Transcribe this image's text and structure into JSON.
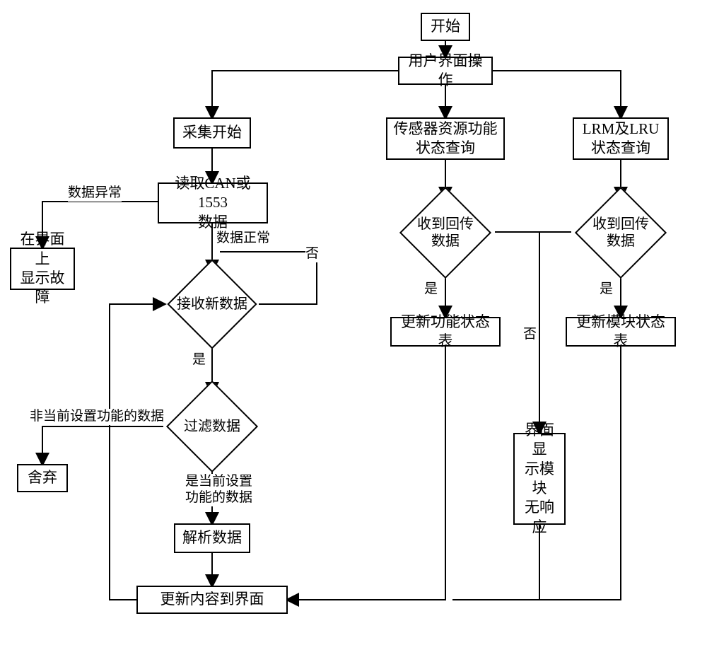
{
  "nodes": {
    "start": "开始",
    "user_interface_ops": "用户界面操作",
    "collect_start": "采集开始",
    "read_can_1553": "读取CAN或1553\n数据",
    "sensor_query": "传感器资源功能\n状态查询",
    "lrm_lru_query": "LRM及LRU\n状态查询",
    "recv_new_data": "接收新数据",
    "recv_return_data1": "收到回传数据",
    "recv_return_data2": "收到回传数据",
    "filter_data": "过滤数据",
    "display_fault": "在界面上\n显示故障",
    "discard": "舍弃",
    "parse_data": "解析数据",
    "update_func_table": "更新功能状态表",
    "update_module_table": "更新模块状态表",
    "module_no_response": "界面显\n示模块\n无响应",
    "update_ui": "更新内容到界面"
  },
  "labels": {
    "data_abnormal": "数据异常",
    "data_normal": "数据正常",
    "yes": "是",
    "no": "否",
    "not_current_func_data": "非当前设置功能的数据",
    "is_current_func_data": "是当前设置\n功能的数据"
  },
  "chart_data": {
    "type": "flowchart",
    "title": "",
    "nodes": [
      {
        "id": "start",
        "type": "terminator",
        "text": "开始"
      },
      {
        "id": "ui_ops",
        "type": "process",
        "text": "用户界面操作"
      },
      {
        "id": "collect_start",
        "type": "process",
        "text": "采集开始"
      },
      {
        "id": "sensor_query",
        "type": "process",
        "text": "传感器资源功能状态查询"
      },
      {
        "id": "lrm_query",
        "type": "process",
        "text": "LRM及LRU状态查询"
      },
      {
        "id": "read_data",
        "type": "process",
        "text": "读取CAN或1553数据"
      },
      {
        "id": "recv_new",
        "type": "decision",
        "text": "接收新数据"
      },
      {
        "id": "recv_ret1",
        "type": "decision",
        "text": "收到回传数据"
      },
      {
        "id": "recv_ret2",
        "type": "decision",
        "text": "收到回传数据"
      },
      {
        "id": "filter",
        "type": "decision",
        "text": "过滤数据"
      },
      {
        "id": "fault",
        "type": "process",
        "text": "在界面上显示故障"
      },
      {
        "id": "discard",
        "type": "process",
        "text": "舍弃"
      },
      {
        "id": "parse",
        "type": "process",
        "text": "解析数据"
      },
      {
        "id": "upd_func",
        "type": "process",
        "text": "更新功能状态表"
      },
      {
        "id": "upd_mod",
        "type": "process",
        "text": "更新模块状态表"
      },
      {
        "id": "no_resp",
        "type": "process",
        "text": "界面显示模块无响应"
      },
      {
        "id": "upd_ui",
        "type": "process",
        "text": "更新内容到界面"
      }
    ],
    "edges": [
      {
        "from": "start",
        "to": "ui_ops"
      },
      {
        "from": "ui_ops",
        "to": "collect_start"
      },
      {
        "from": "ui_ops",
        "to": "sensor_query"
      },
      {
        "from": "ui_ops",
        "to": "lrm_query"
      },
      {
        "from": "collect_start",
        "to": "read_data"
      },
      {
        "from": "read_data",
        "to": "fault",
        "label": "数据异常"
      },
      {
        "from": "read_data",
        "to": "recv_new",
        "label": "数据正常"
      },
      {
        "from": "recv_new",
        "to": "recv_new",
        "label": "否"
      },
      {
        "from": "recv_new",
        "to": "filter",
        "label": "是"
      },
      {
        "from": "filter",
        "to": "discard",
        "label": "非当前设置功能的数据"
      },
      {
        "from": "filter",
        "to": "parse",
        "label": "是当前设置功能的数据"
      },
      {
        "from": "parse",
        "to": "upd_ui"
      },
      {
        "from": "sensor_query",
        "to": "recv_ret1"
      },
      {
        "from": "recv_ret1",
        "to": "upd_func",
        "label": "是"
      },
      {
        "from": "recv_ret1",
        "to": "no_resp",
        "label": "否"
      },
      {
        "from": "lrm_query",
        "to": "recv_ret2"
      },
      {
        "from": "recv_ret2",
        "to": "upd_mod",
        "label": "是"
      },
      {
        "from": "recv_ret2",
        "to": "no_resp",
        "label": "否"
      },
      {
        "from": "upd_func",
        "to": "upd_ui"
      },
      {
        "from": "upd_mod",
        "to": "upd_ui"
      },
      {
        "from": "no_resp",
        "to": "upd_ui"
      },
      {
        "from": "upd_ui",
        "to": "recv_new"
      }
    ]
  }
}
